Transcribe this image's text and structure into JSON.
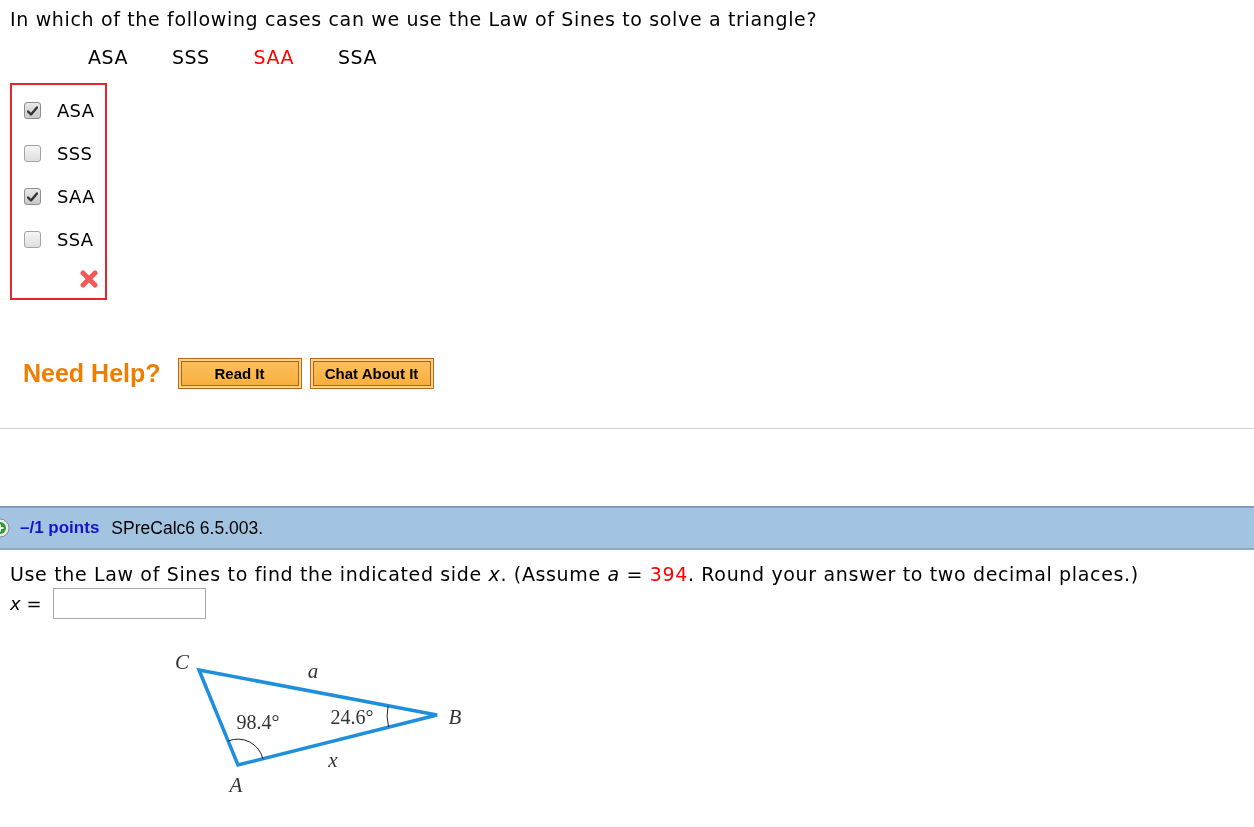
{
  "question_1": {
    "prompt": "In which of the following cases can we use the Law of Sines to solve a triangle?",
    "options": [
      {
        "label": "ASA",
        "color": "#000000"
      },
      {
        "label": "SSS",
        "color": "#000000"
      },
      {
        "label": "SAA",
        "color": "#ff0000"
      },
      {
        "label": "SSA",
        "color": "#000000"
      }
    ],
    "choices": [
      {
        "label": "ASA",
        "checked": true
      },
      {
        "label": "SSS",
        "checked": false
      },
      {
        "label": "SAA",
        "checked": true
      },
      {
        "label": "SSA",
        "checked": false
      }
    ],
    "correct": false,
    "help": {
      "label": "Need Help?",
      "buttons": [
        "Read It",
        "Chat About It"
      ]
    }
  },
  "question_2": {
    "points": "–/1 points",
    "source": "SPreCalc6 6.5.003.",
    "prompt_start": "Use the Law of Sines to find the indicated side *x*. (Assume *a* = ",
    "given_value": "394",
    "prompt_end": ". Round your answer to two decimal places.)",
    "answer_label": "*x* =",
    "figure": {
      "vertices": [
        "C",
        "B",
        "A"
      ],
      "sides": [
        "a",
        "x"
      ],
      "angles": [
        "98.4°",
        "24.6°"
      ]
    }
  }
}
